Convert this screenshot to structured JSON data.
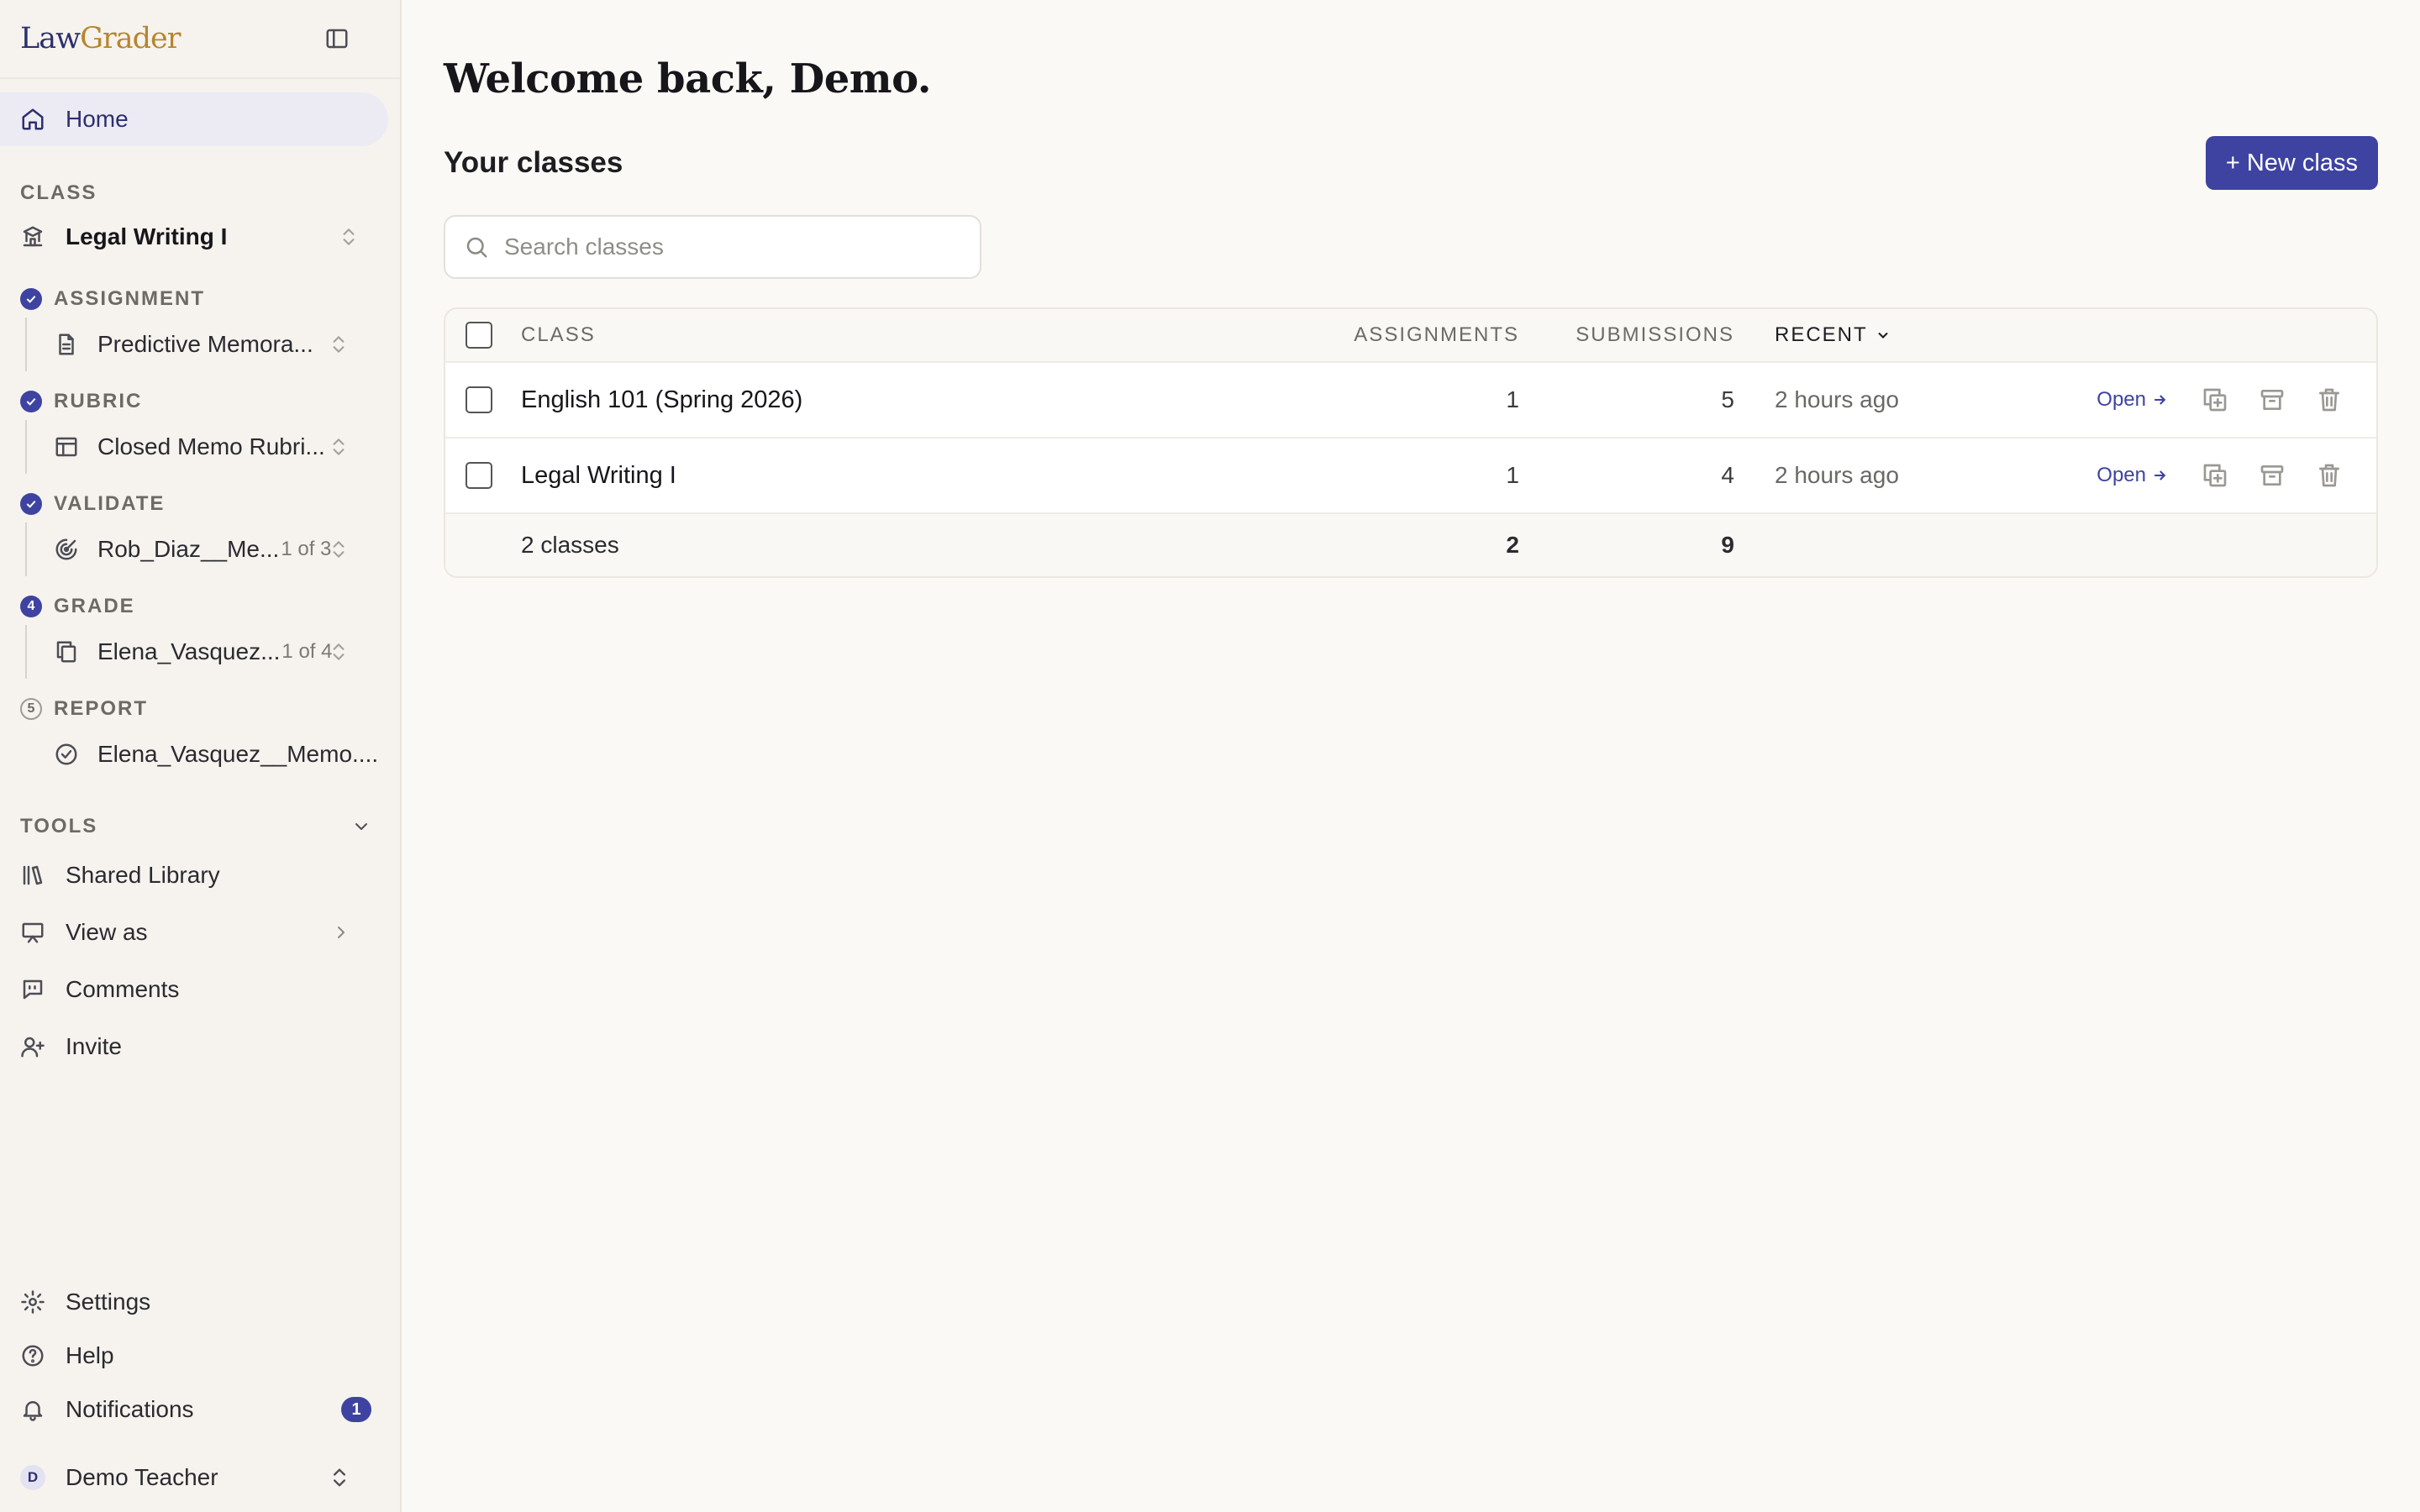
{
  "brand": {
    "part1": "Law",
    "part2": "Grader"
  },
  "sidebar": {
    "home_label": "Home",
    "class_section": "CLASS",
    "class_name": "Legal Writing I",
    "steps": [
      {
        "label": "ASSIGNMENT",
        "state": "done",
        "item": "Predictive Memora...",
        "count": ""
      },
      {
        "label": "RUBRIC",
        "state": "done",
        "item": "Closed Memo Rubri...",
        "count": ""
      },
      {
        "label": "VALIDATE",
        "state": "done",
        "item": "Rob_Diaz__Me...",
        "count": "1 of 3"
      },
      {
        "label": "GRADE",
        "state": "current",
        "number": "4",
        "item": "Elena_Vasquez...",
        "count": "1 of 4"
      },
      {
        "label": "REPORT",
        "state": "pending",
        "number": "5",
        "item": "Elena_Vasquez__Memo....",
        "count": ""
      }
    ],
    "tools_label": "TOOLS",
    "tools": [
      "Shared Library",
      "View as",
      "Comments",
      "Invite"
    ],
    "bottom": {
      "settings": "Settings",
      "help": "Help",
      "notifications": "Notifications",
      "notifications_count": "1",
      "user_initial": "D",
      "user_name": "Demo Teacher"
    }
  },
  "main": {
    "welcome": "Welcome back, Demo.",
    "section_title": "Your classes",
    "new_class_button": "+ New class",
    "search_placeholder": "Search classes",
    "table": {
      "headers": {
        "class": "CLASS",
        "assignments": "ASSIGNMENTS",
        "submissions": "SUBMISSIONS",
        "recent": "RECENT"
      },
      "rows": [
        {
          "name": "English 101 (Spring 2026)",
          "assignments": "1",
          "submissions": "5",
          "recent": "2 hours ago",
          "open": "Open"
        },
        {
          "name": "Legal Writing I",
          "assignments": "1",
          "submissions": "4",
          "recent": "2 hours ago",
          "open": "Open"
        }
      ],
      "footer": {
        "label": "2 classes",
        "assignments": "2",
        "submissions": "9"
      }
    }
  },
  "colors": {
    "accent": "#3e43a1",
    "brand_gold": "#b8852d",
    "brand_navy": "#2d2f6e"
  }
}
